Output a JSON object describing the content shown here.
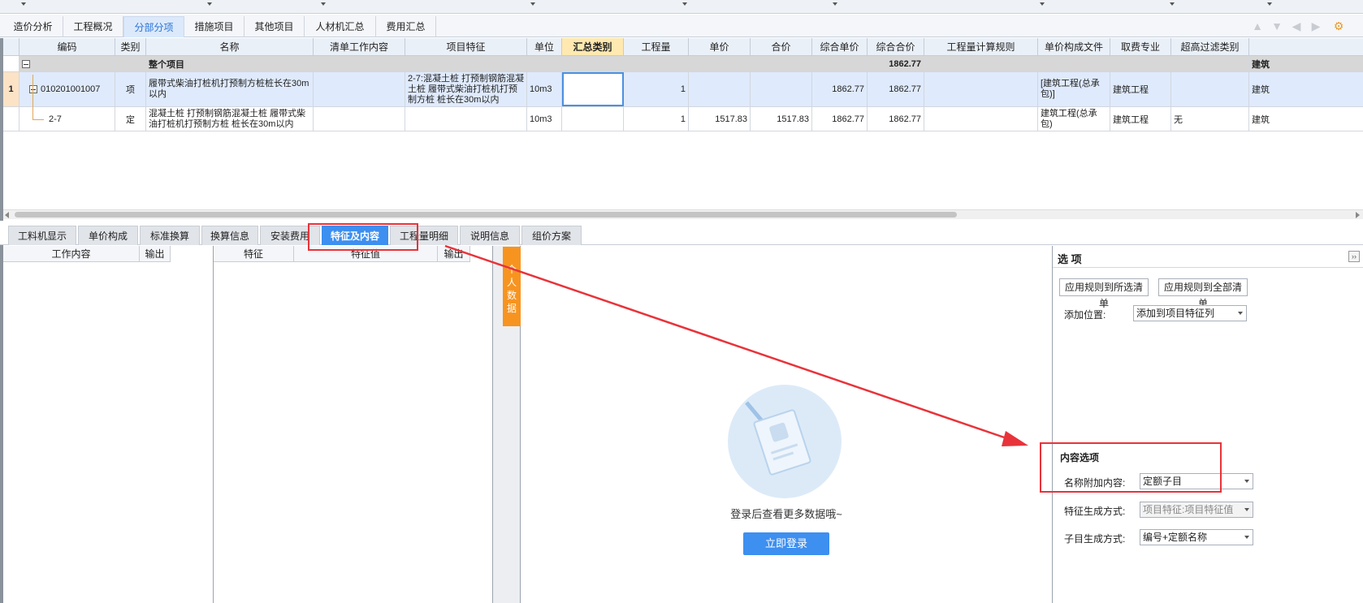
{
  "top_tabs": [
    {
      "label": "造价分析",
      "active": false
    },
    {
      "label": "工程概况",
      "active": false
    },
    {
      "label": "分部分项",
      "active": true
    },
    {
      "label": "措施项目",
      "active": false
    },
    {
      "label": "其他项目",
      "active": false
    },
    {
      "label": "人材机汇总",
      "active": false
    },
    {
      "label": "费用汇总",
      "active": false
    }
  ],
  "grid": {
    "headers": [
      "编码",
      "类别",
      "名称",
      "清单工作内容",
      "项目特征",
      "单位",
      "汇总类别",
      "工程量",
      "单价",
      "合价",
      "综合单价",
      "综合合价",
      "工程量计算规则",
      "单价构成文件",
      "取费专业",
      "超高过滤类别"
    ],
    "total_row": {
      "label": "整个项目",
      "amount": "1862.77",
      "trailing": "建筑"
    },
    "rows": [
      {
        "index": "1",
        "code": "010201001007",
        "type": "项",
        "name": "履带式柴油打桩机打预制方桩桩长在30m以内",
        "content": "",
        "feature": "2-7:混凝土桩 打预制钢筋混凝土桩 履带式柴油打桩机打预制方桩 桩长在30m以内",
        "unit": "10m3",
        "category": "",
        "qty": "1",
        "price": "",
        "total": "",
        "unit_comp": "1862.77",
        "total_comp": "1862.77",
        "rule": "",
        "file": "[建筑工程(总承包)]",
        "major": "建筑工程",
        "filter": "",
        "trailing": "建筑"
      },
      {
        "index": "",
        "code": "2-7",
        "type": "定",
        "name": "混凝土桩 打预制钢筋混凝土桩 履带式柴油打桩机打预制方桩 桩长在30m以内",
        "content": "",
        "feature": "",
        "unit": "10m3",
        "category": "",
        "qty": "1",
        "price": "1517.83",
        "total": "1517.83",
        "unit_comp": "1862.77",
        "total_comp": "1862.77",
        "rule": "",
        "file": "建筑工程(总承包)",
        "major": "建筑工程",
        "filter": "无",
        "trailing": "建筑"
      }
    ]
  },
  "bottom_tabs": [
    {
      "label": "工料机显示",
      "active": false
    },
    {
      "label": "单价构成",
      "active": false
    },
    {
      "label": "标准换算",
      "active": false
    },
    {
      "label": "换算信息",
      "active": false
    },
    {
      "label": "安装费用",
      "active": false
    },
    {
      "label": "特征及内容",
      "active": true
    },
    {
      "label": "工程量明细",
      "active": false
    },
    {
      "label": "说明信息",
      "active": false
    },
    {
      "label": "组价方案",
      "active": false
    }
  ],
  "work_panel": {
    "col_content": "工作内容",
    "col_output": "输出"
  },
  "feature_panel": {
    "col_feature": "特征",
    "col_value": "特征值",
    "col_output": "输出"
  },
  "side_tab": "个人数据",
  "login": {
    "message": "登录后查看更多数据哦~",
    "button": "立即登录"
  },
  "options": {
    "title": "选 项",
    "collapse_glyph": "››",
    "apply_selected": "应用规则到所选清单",
    "apply_all": "应用规则到全部清单",
    "add_position_label": "添加位置:",
    "add_position_value": "添加到项目特征列",
    "content_section": "内容选项",
    "name_append_label": "名称附加内容:",
    "name_append_value": "定额子目",
    "feature_mode_label": "特征生成方式:",
    "feature_mode_value": "项目特征:项目特征值",
    "child_mode_label": "子目生成方式:",
    "child_mode_value": "编号+定额名称"
  },
  "colors": {
    "accent": "#3d8ff0",
    "annotation": "#e8333a",
    "orange": "#f79420"
  }
}
